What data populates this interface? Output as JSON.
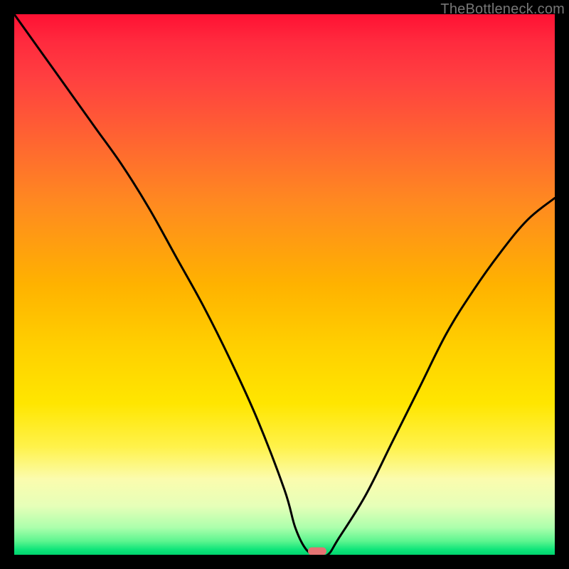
{
  "watermark": "TheBottleneck.com",
  "chart_data": {
    "type": "line",
    "title": "",
    "xlabel": "",
    "ylabel": "",
    "xlim": [
      0,
      100
    ],
    "ylim": [
      0,
      100
    ],
    "background": "vertical-heat-gradient",
    "series": [
      {
        "name": "bottleneck-curve",
        "x": [
          0,
          5,
          10,
          15,
          20,
          25,
          30,
          35,
          40,
          45,
          50,
          52,
          54,
          56,
          58,
          60,
          65,
          70,
          75,
          80,
          85,
          90,
          95,
          100
        ],
        "values": [
          100,
          93,
          86,
          79,
          72,
          64,
          55,
          46,
          36,
          25,
          12,
          5,
          1,
          0,
          0,
          3,
          11,
          21,
          31,
          41,
          49,
          56,
          62,
          66
        ]
      }
    ],
    "marker": {
      "x": 56,
      "y": 0.6,
      "color_hex": "#e57373"
    }
  },
  "colors": {
    "curve_stroke": "#000000",
    "background_black": "#000000"
  }
}
